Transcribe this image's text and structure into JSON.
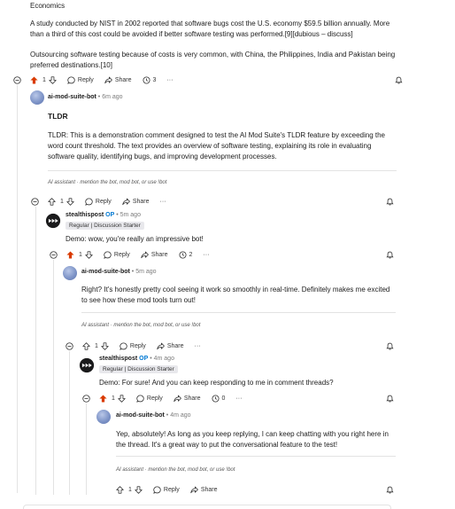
{
  "intro": {
    "heading": "Economics",
    "para1": "A study conducted by NIST in 2002 reported that software bugs cost the U.S. economy $59.5 billion annually. More than a third of this cost could be avoided if better software testing was performed.[9][dubious – discuss]",
    "para2": "Outsourcing software testing because of costs is very common, with China, the Philippines, India and Pakistan being preferred destinations.[10]"
  },
  "labels": {
    "reply": "Reply",
    "share": "Share",
    "op": "OP",
    "sep": "•",
    "more": "···",
    "footer": "AI assistant · mention the bot, mod bot, or use !bot"
  },
  "comments": {
    "c0": {
      "votes": "1",
      "awards": "3",
      "upvoted": true
    },
    "c1": {
      "user": "ai-mod-suite-bot",
      "time": "6m ago",
      "title": "TLDR",
      "body": "TLDR: This is a demonstration comment designed to test the AI Mod Suite's TLDR feature by exceeding the word count threshold. The text provides an overview of software testing, explaining its role in evaluating software quality, identifying bugs, and improving development processes.",
      "votes": "1"
    },
    "c2": {
      "user": "stealthispost",
      "time": "5m ago",
      "flair": "Regular | Discussion Starter",
      "body": "Demo: wow, you're really an impressive bot!",
      "votes": "1",
      "awards": "2",
      "upvoted": true
    },
    "c3": {
      "user": "ai-mod-suite-bot",
      "time": "5m ago",
      "body": "Right? It's honestly pretty cool seeing it work so smoothly in real-time. Definitely makes me excited to see how these mod tools turn out!",
      "votes": "1"
    },
    "c4": {
      "user": "stealthispost",
      "time": "4m ago",
      "flair": "Regular | Discussion Starter",
      "body": "Demo: For sure! And you can keep responding to me in comment threads?",
      "votes": "1",
      "awards": "0",
      "upvoted": true
    },
    "c5": {
      "user": "ai-mod-suite-bot",
      "time": "4m ago",
      "body": "Yep, absolutely! As long as you keep replying, I can keep chatting with you right here in the thread. It's a great way to put the conversational feature to the test!",
      "votes": "1"
    }
  },
  "colors": {
    "upvote_active": "#d93a00",
    "op_blue": "#0079d3"
  }
}
